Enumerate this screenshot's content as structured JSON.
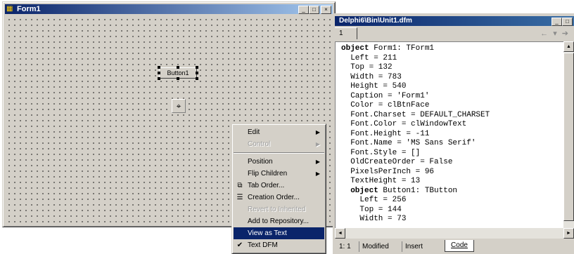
{
  "form_window": {
    "title": "Form1",
    "minimize_glyph": "_",
    "maximize_glyph": "□",
    "close_glyph": "×",
    "button_caption": "Button1",
    "icon_glyph": "▦",
    "component_icon_glyph": "⌖"
  },
  "editor_window": {
    "title": "Delphi6\\Bin\\Unit1.dfm",
    "tab_label": "1",
    "nav_glyphs": "← ▾ ➔",
    "code_lines": [
      {
        "kw": "object",
        "text": " Form1: TForm1",
        "indent": ""
      },
      {
        "kw": "",
        "text": "Left = 211",
        "indent": "  "
      },
      {
        "kw": "",
        "text": "Top = 132",
        "indent": "  "
      },
      {
        "kw": "",
        "text": "Width = 783",
        "indent": "  "
      },
      {
        "kw": "",
        "text": "Height = 540",
        "indent": "  "
      },
      {
        "kw": "",
        "text": "Caption = 'Form1'",
        "indent": "  "
      },
      {
        "kw": "",
        "text": "Color = clBtnFace",
        "indent": "  "
      },
      {
        "kw": "",
        "text": "Font.Charset = DEFAULT_CHARSET",
        "indent": "  "
      },
      {
        "kw": "",
        "text": "Font.Color = clWindowText",
        "indent": "  "
      },
      {
        "kw": "",
        "text": "Font.Height = -11",
        "indent": "  "
      },
      {
        "kw": "",
        "text": "Font.Name = 'MS Sans Serif'",
        "indent": "  "
      },
      {
        "kw": "",
        "text": "Font.Style = []",
        "indent": "  "
      },
      {
        "kw": "",
        "text": "OldCreateOrder = False",
        "indent": "  "
      },
      {
        "kw": "",
        "text": "PixelsPerInch = 96",
        "indent": "  "
      },
      {
        "kw": "",
        "text": "TextHeight = 13",
        "indent": "  "
      },
      {
        "kw": "object",
        "text": " Button1: TButton",
        "indent": "  "
      },
      {
        "kw": "",
        "text": "Left = 256",
        "indent": "    "
      },
      {
        "kw": "",
        "text": "Top = 144",
        "indent": "    "
      },
      {
        "kw": "",
        "text": "Width = 73",
        "indent": "    "
      }
    ],
    "status": {
      "position": "1: 1",
      "modified": "Modified",
      "mode": "Insert",
      "code_tab": "Code"
    },
    "arrow_up": "▲",
    "arrow_down": "▼",
    "arrow_left": "◄",
    "arrow_right": "►"
  },
  "context_menu": {
    "items": [
      {
        "label": "Edit",
        "submenu": true,
        "disabled": false,
        "selected": false,
        "icon": ""
      },
      {
        "label": "Control",
        "submenu": true,
        "disabled": true,
        "selected": false,
        "icon": ""
      },
      {
        "separator": true
      },
      {
        "label": "Position",
        "submenu": true,
        "disabled": false,
        "selected": false,
        "icon": ""
      },
      {
        "label": "Flip Children",
        "submenu": true,
        "disabled": false,
        "selected": false,
        "icon": ""
      },
      {
        "label": "Tab Order...",
        "submenu": false,
        "disabled": false,
        "selected": false,
        "icon": "tab-order-icon"
      },
      {
        "label": "Creation Order...",
        "submenu": false,
        "disabled": false,
        "selected": false,
        "icon": "creation-order-icon"
      },
      {
        "label": "Revert to Inherited",
        "submenu": false,
        "disabled": true,
        "selected": false,
        "icon": ""
      },
      {
        "label": "Add to Repository...",
        "submenu": false,
        "disabled": false,
        "selected": false,
        "icon": ""
      },
      {
        "label": "View as Text",
        "submenu": false,
        "disabled": false,
        "selected": true,
        "icon": ""
      },
      {
        "label": "Text DFM",
        "submenu": false,
        "disabled": false,
        "selected": false,
        "icon": "checkmark-icon"
      }
    ],
    "submenu_arrow": "▶",
    "icon_glyphs": {
      "tab-order-icon": "⧉",
      "creation-order-icon": "☰",
      "checkmark-icon": "✔"
    }
  }
}
